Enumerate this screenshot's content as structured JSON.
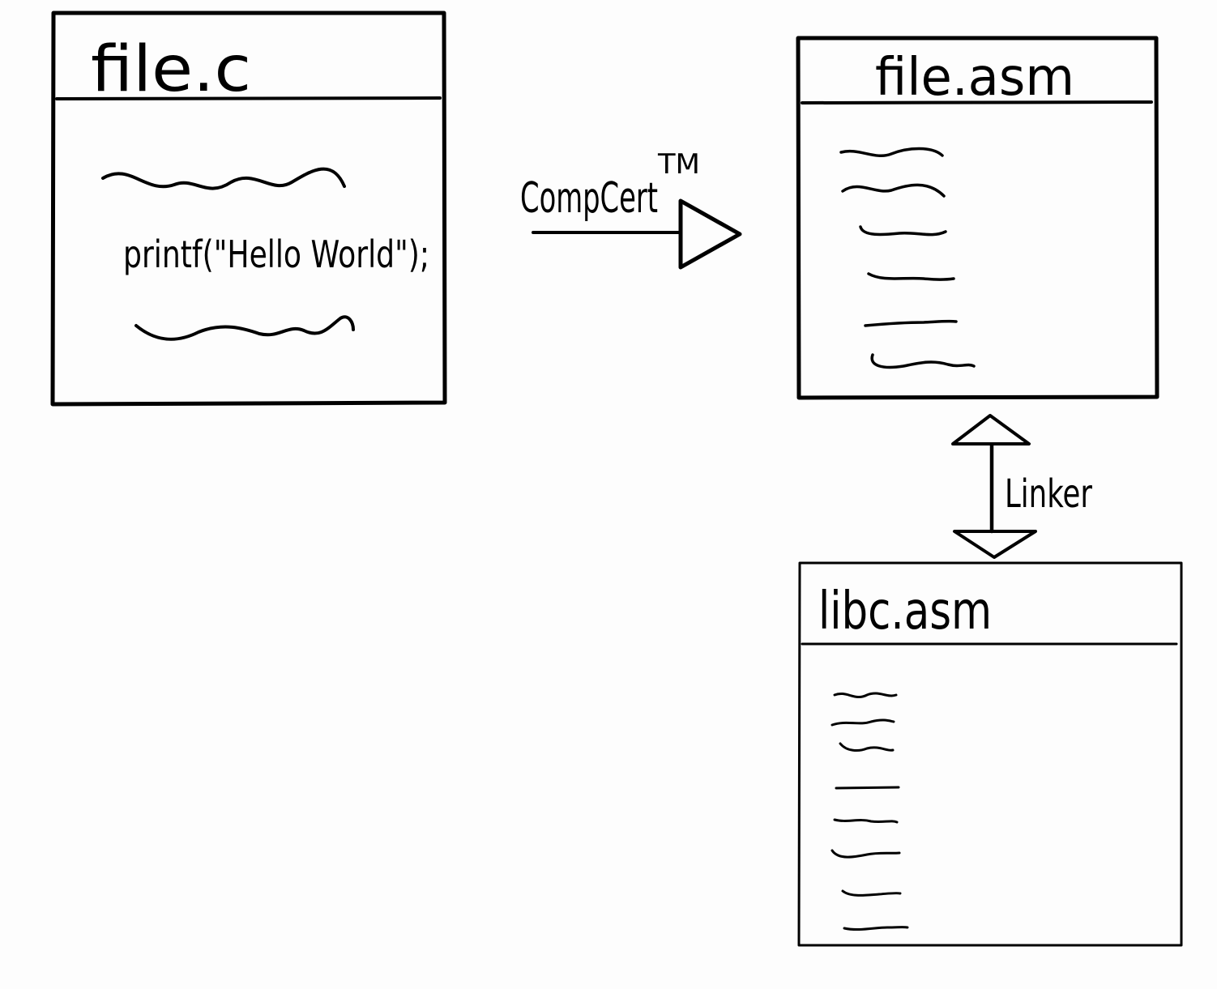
{
  "diagram": {
    "colors": {
      "background": "#fdfdfd",
      "ink": "#000000"
    },
    "source_file": {
      "title": "file.c",
      "code_line": "printf(\"Hello World\");",
      "squiggle_count": 2
    },
    "compiler": {
      "label": "CompCert",
      "trademark": "TM"
    },
    "asm_file": {
      "title": "file.asm",
      "line_count": 6
    },
    "linker": {
      "label": "Linker"
    },
    "lib_file": {
      "title": "libc.asm",
      "line_count": 8
    }
  }
}
